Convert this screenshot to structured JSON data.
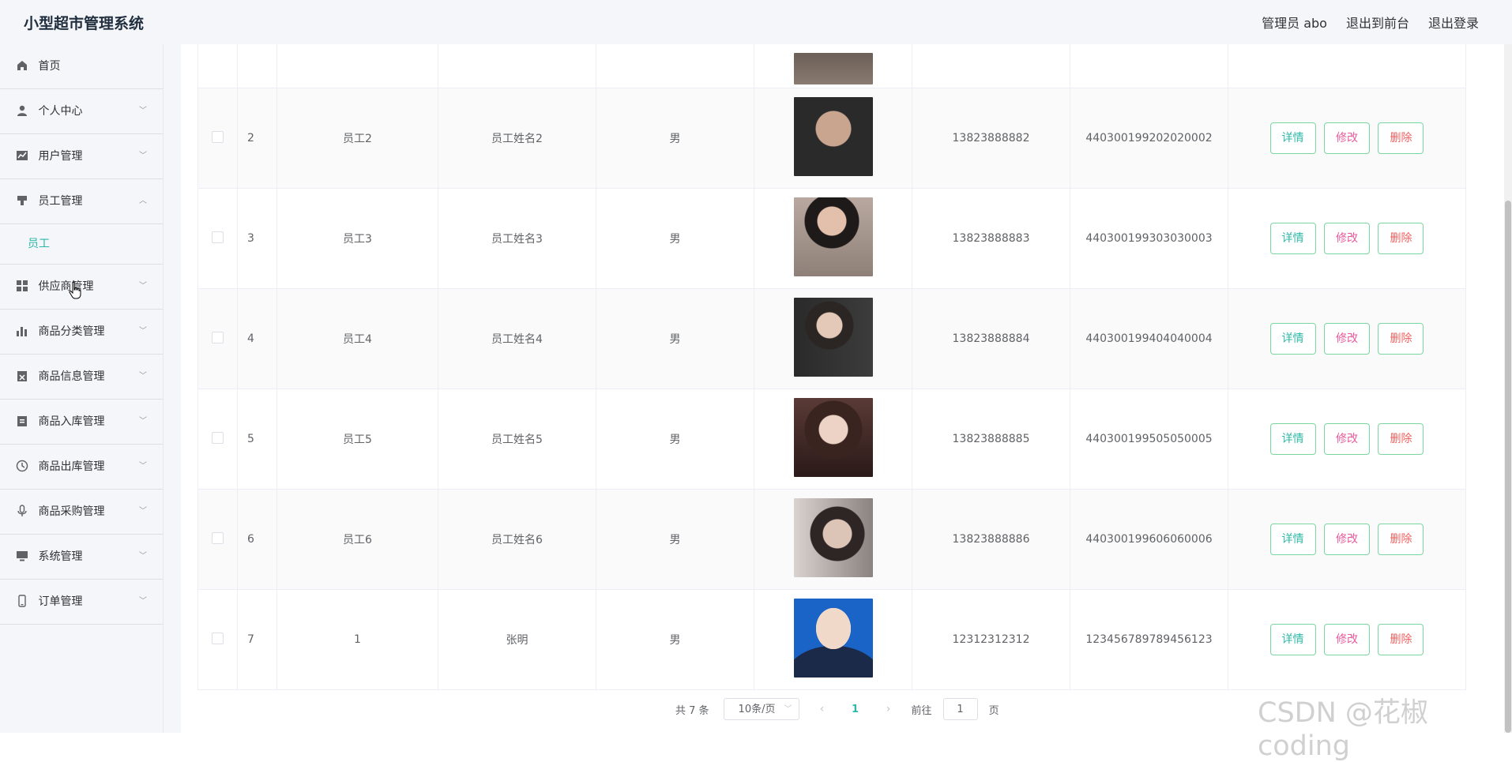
{
  "header": {
    "title": "小型超市管理系统",
    "admin_label": "管理员 abo",
    "back_frontend": "退出到前台",
    "logout": "退出登录"
  },
  "sidebar": {
    "items": [
      {
        "label": "首页",
        "icon": "home-icon"
      },
      {
        "label": "个人中心",
        "icon": "user-icon"
      },
      {
        "label": "用户管理",
        "icon": "chart-icon"
      },
      {
        "label": "员工管理",
        "icon": "brush-icon",
        "expanded": true
      },
      {
        "label": "员工",
        "sub": true
      },
      {
        "label": "供应商管理",
        "icon": "grid-icon"
      },
      {
        "label": "商品分类管理",
        "icon": "bar-chart-icon"
      },
      {
        "label": "商品信息管理",
        "icon": "clipboard-x-icon"
      },
      {
        "label": "商品入库管理",
        "icon": "clipboard-icon"
      },
      {
        "label": "商品出库管理",
        "icon": "clock-icon"
      },
      {
        "label": "商品采购管理",
        "icon": "mic-icon"
      },
      {
        "label": "系统管理",
        "icon": "monitor-icon"
      },
      {
        "label": "订单管理",
        "icon": "phone-icon"
      }
    ]
  },
  "table": {
    "rows": [
      {
        "index": "",
        "account": "",
        "name": "",
        "gender": "",
        "phone": "",
        "id_card": ""
      },
      {
        "index": "2",
        "account": "员工2",
        "name": "员工姓名2",
        "gender": "男",
        "phone": "13823888882",
        "id_card": "440300199202020002"
      },
      {
        "index": "3",
        "account": "员工3",
        "name": "员工姓名3",
        "gender": "男",
        "phone": "13823888883",
        "id_card": "440300199303030003"
      },
      {
        "index": "4",
        "account": "员工4",
        "name": "员工姓名4",
        "gender": "男",
        "phone": "13823888884",
        "id_card": "440300199404040004"
      },
      {
        "index": "5",
        "account": "员工5",
        "name": "员工姓名5",
        "gender": "男",
        "phone": "13823888885",
        "id_card": "440300199505050005"
      },
      {
        "index": "6",
        "account": "员工6",
        "name": "员工姓名6",
        "gender": "男",
        "phone": "13823888886",
        "id_card": "440300199606060006"
      },
      {
        "index": "7",
        "account": "1",
        "name": "张明",
        "gender": "男",
        "phone": "12312312312",
        "id_card": "123456789789456123"
      }
    ],
    "actions": {
      "detail": "详情",
      "edit": "修改",
      "delete": "删除"
    }
  },
  "pagination": {
    "total": "共 7 条",
    "page_size": "10条/页",
    "current_page": "1",
    "goto_label": "前往",
    "goto_value": "1",
    "page_suffix": "页"
  },
  "watermark": "CSDN @花椒coding",
  "colors": {
    "accent": "#2cb8a8",
    "edit": "#e85a9c",
    "delete": "#f06262",
    "button_border": "#7ad6a1",
    "sidebar_bg": "#f4f6fa"
  }
}
